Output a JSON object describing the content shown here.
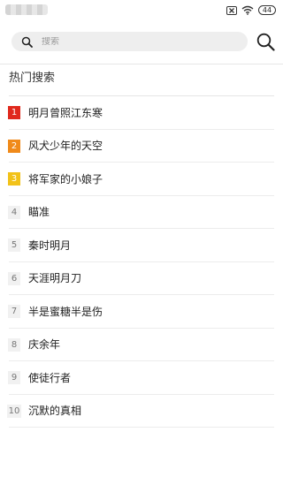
{
  "status_bar": {
    "battery": "44",
    "icons": [
      "sim-x-icon",
      "wifi-icon",
      "battery-icon"
    ],
    "left_content_blurred": true
  },
  "search": {
    "placeholder": "搜索",
    "value": ""
  },
  "hot_search": {
    "title": "热门搜索",
    "items": [
      {
        "rank": "1",
        "text": "明月曾照江东寒"
      },
      {
        "rank": "2",
        "text": "风犬少年的天空"
      },
      {
        "rank": "3",
        "text": "将军家的小娘子"
      },
      {
        "rank": "4",
        "text": "瞄准"
      },
      {
        "rank": "5",
        "text": "秦时明月"
      },
      {
        "rank": "6",
        "text": "天涯明月刀"
      },
      {
        "rank": "7",
        "text": "半是蜜糖半是伤"
      },
      {
        "rank": "8",
        "text": "庆余年"
      },
      {
        "rank": "9",
        "text": "使徒行者"
      },
      {
        "rank": "10",
        "text": "沉默的真相"
      }
    ]
  },
  "colors": {
    "rank_1": "#e0291d",
    "rank_2": "#f08a1a",
    "rank_3": "#f2c219",
    "rank_default_bg": "#f1f1f1",
    "search_box_bg": "#eeeeee"
  }
}
